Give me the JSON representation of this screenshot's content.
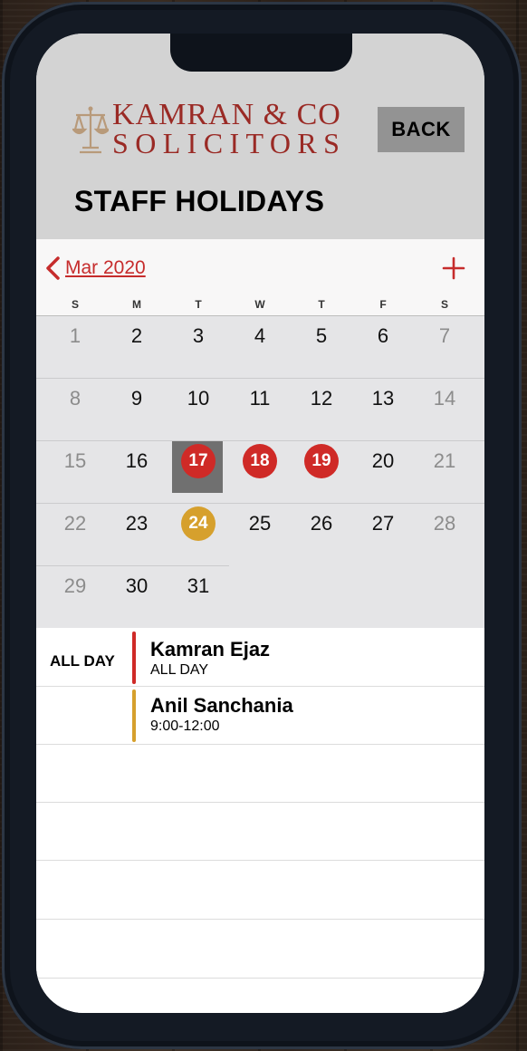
{
  "app": {
    "logo_line1": "KAMRAN & CO",
    "logo_line2": "SOLICITORS",
    "back_label": "BACK",
    "page_title": "STAFF HOLIDAYS"
  },
  "calendar": {
    "month_label": "Mar 2020",
    "weekdays": [
      "S",
      "M",
      "T",
      "W",
      "T",
      "F",
      "S"
    ],
    "weeks": [
      [
        "1",
        "2",
        "3",
        "4",
        "5",
        "6",
        "7"
      ],
      [
        "8",
        "9",
        "10",
        "11",
        "12",
        "13",
        "14"
      ],
      [
        "15",
        "16",
        "17",
        "18",
        "19",
        "20",
        "21"
      ],
      [
        "22",
        "23",
        "24",
        "25",
        "26",
        "27",
        "28"
      ],
      [
        "29",
        "30",
        "31"
      ]
    ],
    "selected_day": "17",
    "marked_red": [
      "17",
      "18",
      "19"
    ],
    "marked_gold": [
      "24"
    ]
  },
  "events": {
    "all_day_label": "ALL DAY",
    "items": [
      {
        "name": "Kamran Ejaz",
        "time": "ALL DAY",
        "color": "#cf2a27"
      },
      {
        "name": "Anil Sanchania",
        "time": "9:00-12:00",
        "color": "#d6a02d"
      }
    ]
  },
  "colors": {
    "brand": "#9a2a25",
    "accent": "#c62c2c",
    "header_bg": "#d3d3d3",
    "calendar_bg": "#e5e5e7"
  }
}
